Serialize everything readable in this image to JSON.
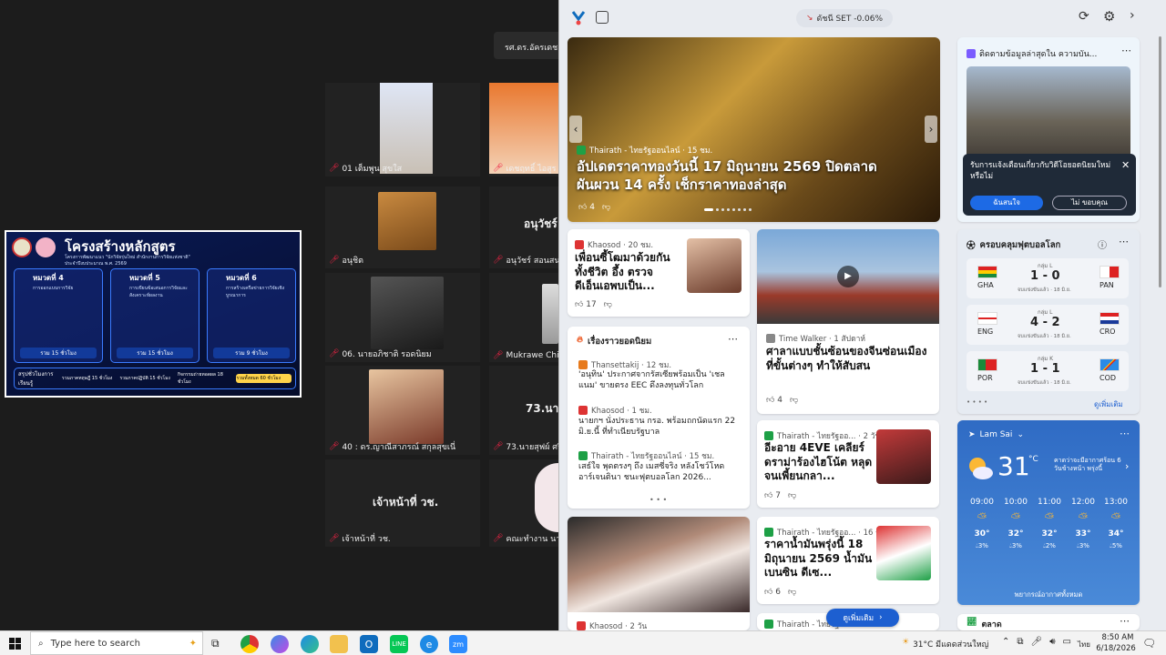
{
  "meeting": {
    "top_name": "รศ.ดร.อัครเดช พ",
    "tiles": [
      {
        "name": "01 เต็มพูน สุขใส",
        "label": ""
      },
      {
        "name": "เดชฤทธิ์ ไอสูร",
        "label": ""
      },
      {
        "name": "อนุชิต",
        "label": ""
      },
      {
        "name": "อนุวัชร์ สอนสนาม",
        "label": "อนุวัชร์"
      },
      {
        "name": "06. นายอภิชาติ รอดนิยม",
        "label": ""
      },
      {
        "name": "Mukrawe Chimp",
        "label": ""
      },
      {
        "name": "40 : ดร.ญาณีสาภรณ์ สกุลสุขเนี่",
        "label": ""
      },
      {
        "name": "73.นายสุฟผ์ ศรี",
        "label": "73.นาย"
      },
      {
        "name": "เจ้าหน้าที่ วช.",
        "label": "เจ้าหน้าที่ วช."
      },
      {
        "name": "คณะทำงาน นายร",
        "label": ""
      }
    ],
    "slide": {
      "title": "โครงสร้างหลักสูตร",
      "subtitle": "โครงการพัฒนาแนว \"นักวิจัยรุ่นใหม่ สำนักงานการวิจัยแห่งชาติ\"",
      "year": "ประจำปีงบประมาณ พ.ศ. 2569",
      "modules": [
        {
          "head": "หมวดที่ 4",
          "sub": "การออกแบบการวิจัย",
          "total": "รวม 15 ชั่วโมง"
        },
        {
          "head": "หมวดที่ 5",
          "sub": "การเขียนข้อเสนอการวิจัยและสังเคราะห์ผลงาน",
          "total": "รวม 15 ชั่วโมง"
        },
        {
          "head": "หมวดที่ 6",
          "sub": "การสร้างเครือข่ายการวิจัยเชิงบูรณาการ",
          "total": "รวม 9 ชั่วโมง"
        }
      ],
      "summary": "สรุปชั่วโมงการเรียนรู้",
      "summary_items": [
        "รวมภาคทฤษฎี 15 ชั่วโมง",
        "รวมภาคปฏิบัติ 15 ชั่วโมง",
        "กิจกรรมถ่ายทอดผล 18 ชั่วโมง",
        "รวมทั้งหมด 60 ชั่วโมง"
      ]
    }
  },
  "widgets": {
    "market": "ดัชนี SET -0.06%",
    "hero": {
      "source": "Thairath - ไทยรัฐออนไลน์ · 15 ชม.",
      "headline": "อัปเดตราคาทองวันนี้ 17 มิถุนายน 2569 ปิดตลาดผันผวน 14 ครั้ง เช็กราคาทองล่าสุด",
      "likes": "4"
    },
    "promo": {
      "title": "ติดตามข้อมูลล่าสุดใน ความบัน...",
      "prompt": "รับการแจ้งเตือนเกี่ยวกับวิดีโอยอดนิยมใหม่หรือไม่",
      "yes": "ฉันสนใจ",
      "no": "ไม่ ขอบคุณ"
    },
    "khaosod": {
      "source": "Khaosod · 20 ชม.",
      "headline": "เพื่อนซี้โฒมาด้วยกัน ทั้งชีวิต อึ้ง ตรวจ ดีเอ็นเอพบเป็น...",
      "likes": "17"
    },
    "trending": {
      "title": "เรื่องราวยอดนิยม",
      "items": [
        {
          "source": "Thansettakij · 12 ชม.",
          "text": "'อนุทิน' ประกาศจากรัสเซียพร้อมเป็น 'เชลแนม' ขายตรง EEC ดึงลงทุนทั่วโลก"
        },
        {
          "source": "Khaosod · 1 ชม.",
          "text": "นายกฯ นั่งประธาน กรอ. พร้อมถกนัดแรก 22 มิ.ย.นี้ ที่ทำเนียบรัฐบาล"
        },
        {
          "source": "Thairath - ไทยรัฐออนไลน์ · 15 ชม.",
          "text": "เสธ์ใจ พุดตรงๆ ถึง เมสซี่จริง หลังโชว์โหด อาร์เจนตินา ชนะฟุตบอลโลก 2026..."
        }
      ]
    },
    "temple": {
      "source": "Time Walker · 1 สัปดาห์",
      "headline": "ศาลาแบบชั้นซ้อนของจีนซ่อนเมืองที่ขั้นต่างๆ ทำให้สับสน",
      "likes": "4"
    },
    "fourEve": {
      "source": "Thairath - ไทยรัฐออ... · 2 วัน",
      "headline": "อีะอาย 4EVE เคลียร์ ดราม่าร้องไฮโน้ต หลุดจนเพี้ยนกลา...",
      "likes": "7"
    },
    "oil": {
      "source": "Thairath - ไทยรัฐออ... · 16 ชม.",
      "headline": "ราคาน้ำมันพรุ่งนี้ 18 มิถุนายน 2569 น้ำมันเบนซิน ดีเซ...",
      "likes": "6"
    },
    "bottom_left": {
      "source": "Khaosod · 2 วัน"
    },
    "bottom_mid": {
      "source": "Thairath - ไทยรัฐออ..."
    },
    "see_more": "ดูเพิ่มเติม",
    "football": {
      "title": "ครอบคลุมฟุตบอลโลก",
      "matches": [
        {
          "group": "กลุ่ม L",
          "home": "GHA",
          "away": "PAN",
          "score": "1 - 0",
          "note": "จบเเข่งขันแล้ว · 18 มิ.ย."
        },
        {
          "group": "กลุ่ม L",
          "home": "ENG",
          "away": "CRO",
          "score": "4 - 2",
          "note": "จบเเข่งขันแล้ว · 18 มิ.ย."
        },
        {
          "group": "กลุ่ม K",
          "home": "POR",
          "away": "COD",
          "score": "1 - 1",
          "note": "จบเเข่งขันแล้ว · 18 มิ.ย."
        }
      ],
      "more": "ดูเพิ่มเติม"
    },
    "weather": {
      "location": "Lam Sai",
      "temp": "31",
      "unit": "°C",
      "alert": "คาดว่าจะมีอากาศร้อน 6 วันข้างหน้า พรุ่งนี้",
      "hours": [
        {
          "t": "09:00",
          "temp": "30°",
          "rain": "3%"
        },
        {
          "t": "10:00",
          "temp": "32°",
          "rain": "3%"
        },
        {
          "t": "11:00",
          "temp": "32°",
          "rain": "2%"
        },
        {
          "t": "12:00",
          "temp": "33°",
          "rain": "3%"
        },
        {
          "t": "13:00",
          "temp": "34°",
          "rain": "5%"
        }
      ],
      "forecast": "พยากรณ์อากาศทั้งหมด"
    },
    "market_card": {
      "title": "ตลาด"
    }
  },
  "taskbar": {
    "search": "Type here to search",
    "weather": "31°C มีแดดส่วนใหญ่",
    "lang": "ไทย",
    "time": "8:50 AM",
    "date": "6/18/2026"
  },
  "colors": {
    "accent": "#0f6cbd",
    "panel": "#e9ecf1",
    "weather": "#3b74c6"
  }
}
